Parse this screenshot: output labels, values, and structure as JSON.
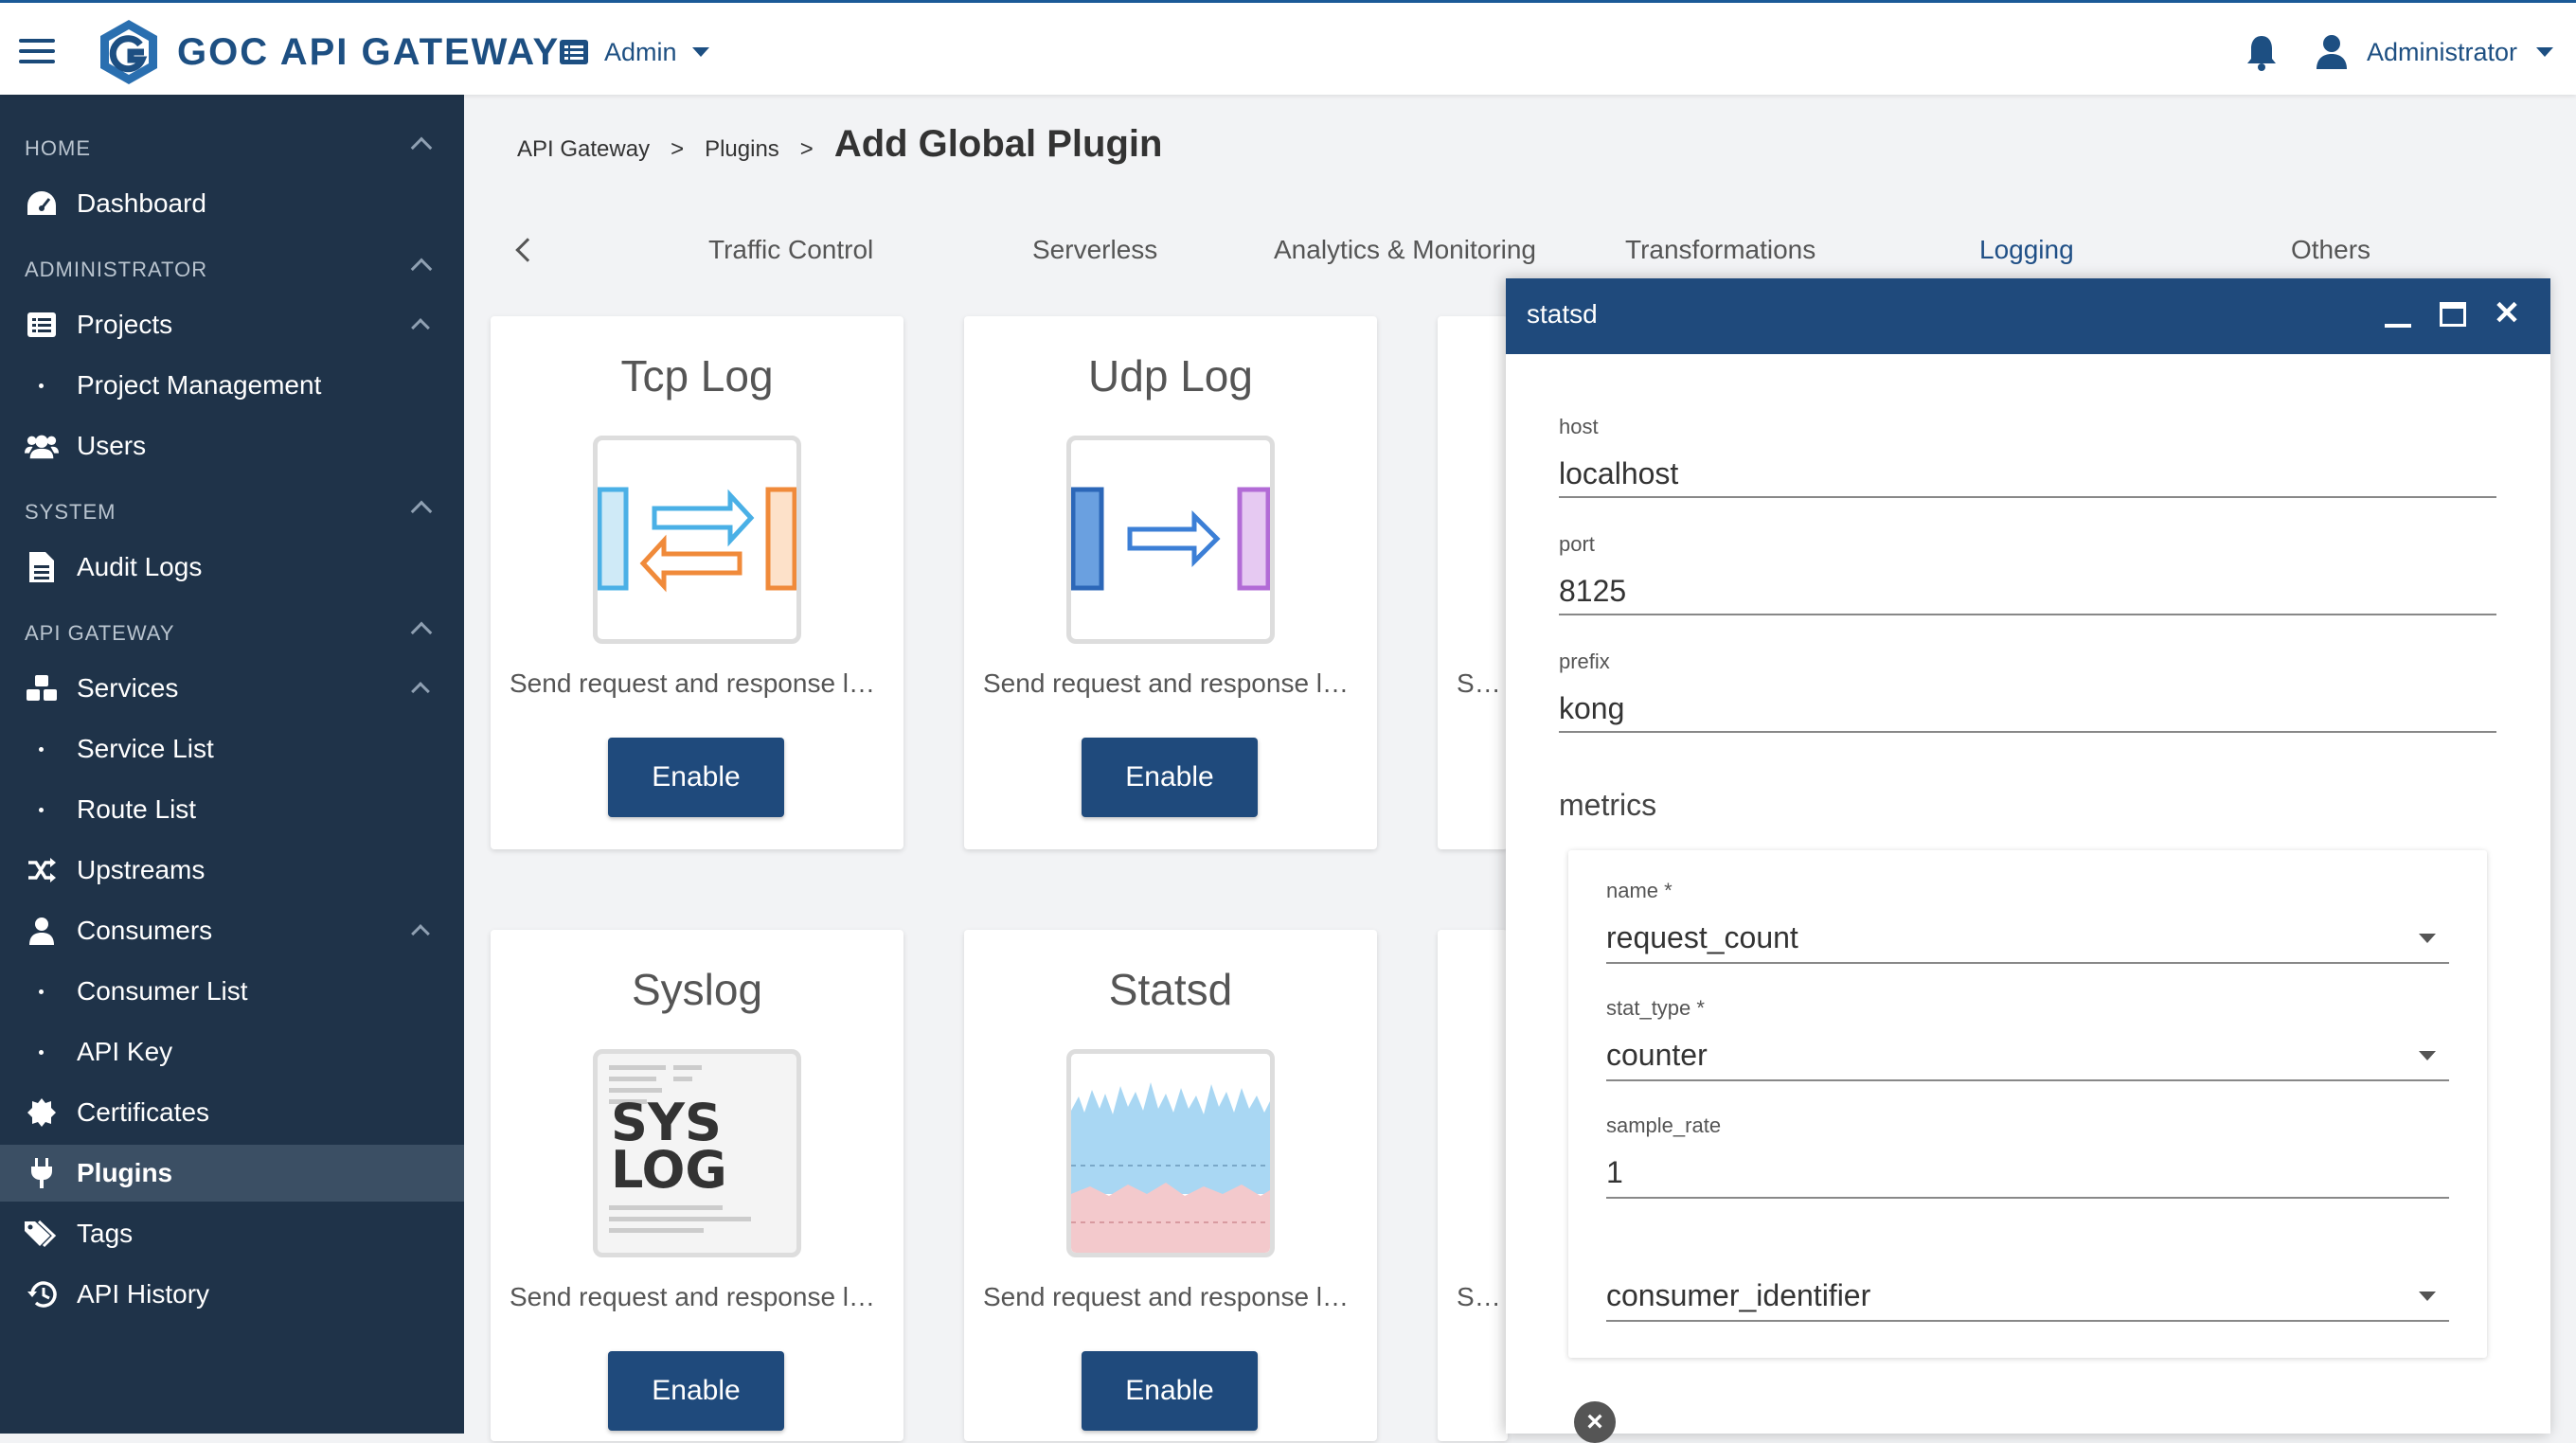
{
  "header": {
    "brand": "GOC API GATEWAY",
    "workspace": "Admin",
    "user": "Administrator"
  },
  "sidebar": {
    "sections": [
      {
        "label": "HOME"
      },
      {
        "label": "ADMINISTRATOR"
      },
      {
        "label": "SYSTEM"
      },
      {
        "label": "API GATEWAY"
      }
    ],
    "items": [
      {
        "label": "Dashboard",
        "icon": "gauge-icon"
      },
      {
        "label": "Projects",
        "icon": "list-icon"
      },
      {
        "label": "Project Management"
      },
      {
        "label": "Users",
        "icon": "users-icon"
      },
      {
        "label": "Audit Logs",
        "icon": "file-icon"
      },
      {
        "label": "Services",
        "icon": "cubes-icon"
      },
      {
        "label": "Service List"
      },
      {
        "label": "Route List"
      },
      {
        "label": "Upstreams",
        "icon": "shuffle-icon"
      },
      {
        "label": "Consumers",
        "icon": "user-icon"
      },
      {
        "label": "Consumer List"
      },
      {
        "label": "API Key"
      },
      {
        "label": "Certificates",
        "icon": "certificate-icon"
      },
      {
        "label": "Plugins",
        "icon": "plug-icon"
      },
      {
        "label": "Tags",
        "icon": "tags-icon"
      },
      {
        "label": "API History",
        "icon": "history-icon"
      }
    ]
  },
  "breadcrumb": {
    "items": [
      "API Gateway",
      "Plugins"
    ],
    "separator": ">",
    "title": "Add Global Plugin"
  },
  "tabs": [
    "Traffic Control",
    "Serverless",
    "Analytics & Monitoring",
    "Transformations",
    "Logging",
    "Others"
  ],
  "active_tab": "Logging",
  "cards": [
    {
      "title": "Tcp Log",
      "desc": "Send request and response logs",
      "button": "Enable"
    },
    {
      "title": "Udp Log",
      "desc": "Send request and response logs",
      "button": "Enable"
    },
    {
      "desc": "Send request and response logs"
    },
    {
      "title": "Syslog",
      "desc": "Send request and response logs",
      "button": "Enable"
    },
    {
      "title": "Statsd",
      "desc": "Send request and response logs",
      "button": "Enable"
    },
    {
      "desc": "Send request and response logs"
    }
  ],
  "syslog_logo": [
    "SYS",
    "LOG"
  ],
  "dialog": {
    "title": "statsd",
    "fields": [
      {
        "label": "host",
        "value": "localhost"
      },
      {
        "label": "port",
        "value": "8125"
      },
      {
        "label": "prefix",
        "value": "kong"
      }
    ],
    "metrics_label": "metrics",
    "metric": {
      "name_label": "name *",
      "name_value": "request_count",
      "stat_type_label": "stat_type *",
      "stat_type_value": "counter",
      "sample_rate_label": "sample_rate",
      "sample_rate_value": "1",
      "consumer_identifier_value": "consumer_identifier"
    }
  },
  "colors": {
    "sidebar": "#1f3349",
    "primary": "#1f4a7c",
    "active_tab": "#1f4f86"
  }
}
